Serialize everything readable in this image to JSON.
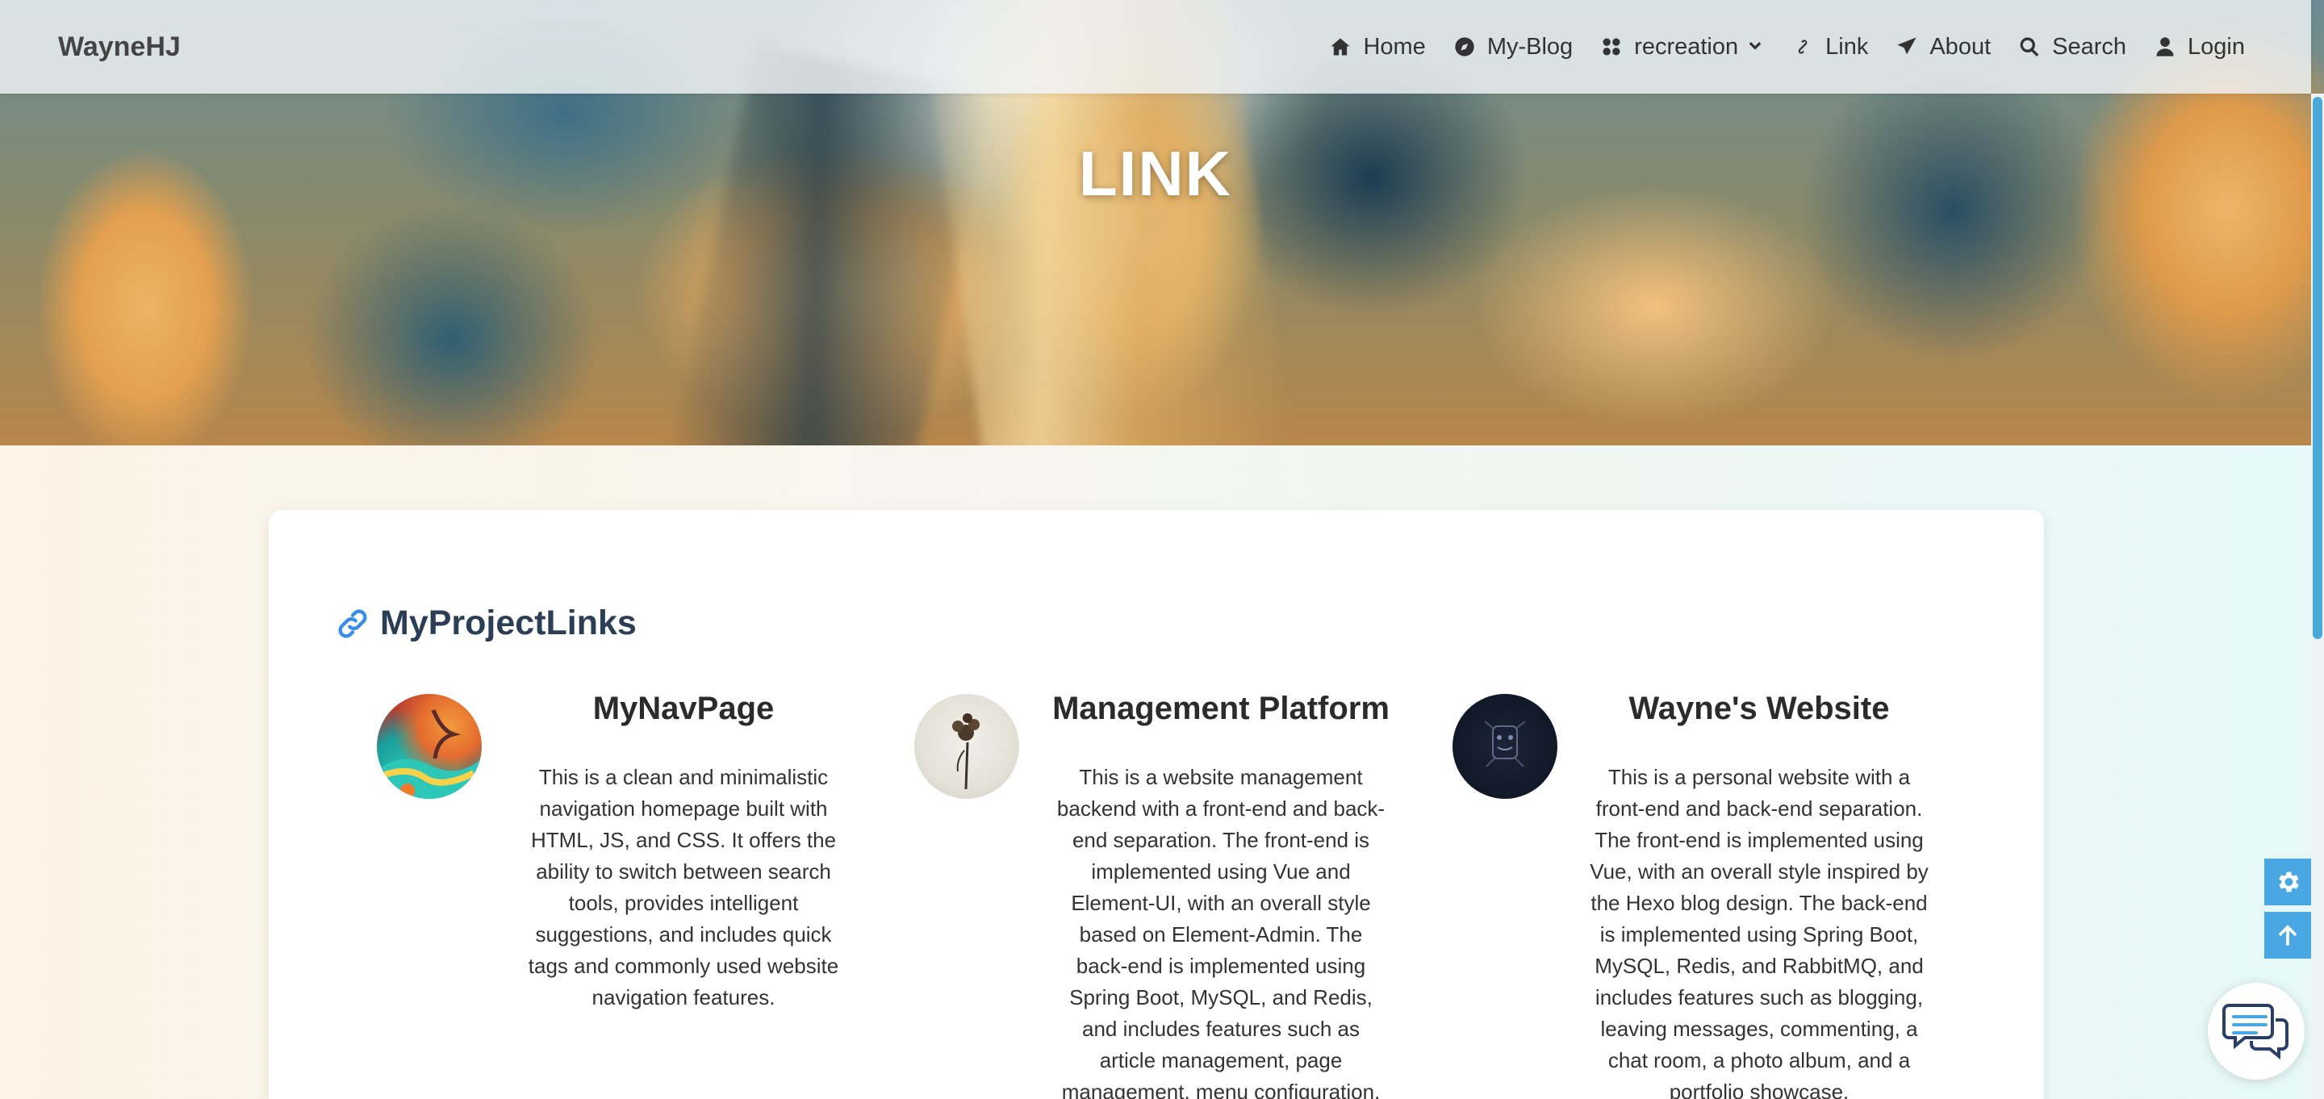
{
  "nav": {
    "brand": "WayneHJ",
    "items": [
      {
        "label": "Home",
        "icon": "home-icon"
      },
      {
        "label": "My-Blog",
        "icon": "compass-icon"
      },
      {
        "label": "recreation",
        "icon": "grid-icon",
        "dropdown": true
      },
      {
        "label": "Link",
        "icon": "link-icon"
      },
      {
        "label": "About",
        "icon": "paper-plane-icon"
      },
      {
        "label": "Search",
        "icon": "search-icon"
      },
      {
        "label": "Login",
        "icon": "user-icon"
      }
    ]
  },
  "hero": {
    "title": "LINK"
  },
  "section": {
    "title": "MyProjectLinks",
    "icon": "link-icon",
    "items": [
      {
        "title": "MyNavPage",
        "description": "This is a clean and minimalistic navigation homepage built with HTML, JS, and CSS. It offers the ability to switch between search tools, provides intelligent suggestions, and includes quick tags and commonly used website navigation features."
      },
      {
        "title": "Management Platform",
        "description": "This is a website management backend with a front-end and back-end separation. The front-end is implemented using Vue and Element-UI, with an overall style based on Element-Admin. The back-end is implemented using Spring Boot, MySQL, and Redis, and includes features such as article management, page management, menu configuration, user"
      },
      {
        "title": "Wayne's Website",
        "description": "This is a personal website with a front-end and back-end separation. The front-end is implemented using Vue, with an overall style inspired by the Hexo blog design. The back-end is implemented using Spring Boot, MySQL, Redis, and RabbitMQ, and includes features such as blogging, leaving messages, commenting, a chat room, a photo album, and a portfolio showcase."
      }
    ]
  },
  "widgets": {
    "settings_icon": "gear-icon",
    "top_icon": "arrow-up-icon",
    "chat_icon": "chat-bubbles-icon"
  },
  "colors": {
    "accent": "#49a8e3",
    "link_icon": "#3a8ee6",
    "title": "#2c3e55"
  }
}
